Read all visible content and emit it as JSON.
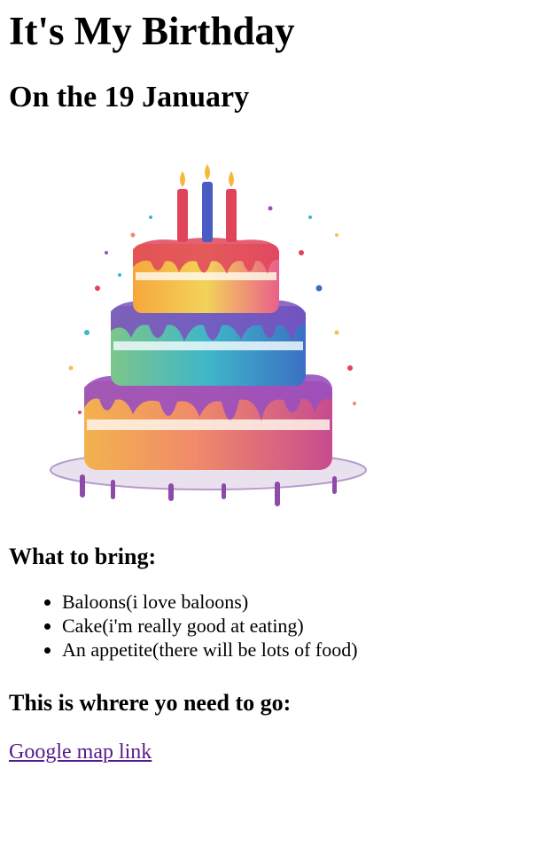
{
  "header": {
    "title": "It's My Birthday",
    "subtitle": "On the 19 January"
  },
  "image": {
    "icon": "birthday-cake-illustration",
    "colors": {
      "candle_red": "#e0445a",
      "candle_blue": "#4a5bc4",
      "tier_top": "#f2c14e",
      "tier_middle": "#3fb6c9",
      "tier_bottom": "#f08a6a",
      "icing": "#9a4fbf",
      "plate": "#e9e2ee"
    }
  },
  "bring": {
    "heading": "What to bring:",
    "items": [
      "Baloons(i love baloons)",
      "Cake(i'm really good at eating)",
      "An appetite(there will be lots of food)"
    ]
  },
  "location": {
    "heading": "This is whrere yo need to go:",
    "link_text": "Google map link",
    "link_color": "#551a8b"
  }
}
